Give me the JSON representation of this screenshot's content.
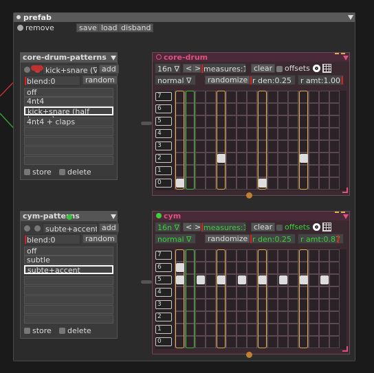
{
  "prefab": {
    "title": "prefab",
    "remove_label": "remove",
    "save_label": "save",
    "load_label": "load",
    "disband_label": "disband"
  },
  "drum_patterns": {
    "title": "core-drum-patterns",
    "selected": "kick+snare (∇",
    "add_label": "add",
    "blend": "blend:0",
    "random_label": "random",
    "items": [
      "off",
      "4nt4",
      "kick+snare (half tempo)",
      "4nt4 + claps"
    ],
    "store_label": "store",
    "delete_label": "delete"
  },
  "cym_patterns": {
    "title": "cym-patterns",
    "selected": "subte+accent",
    "add_label": "add",
    "blend": "blend:0",
    "random_label": "random",
    "items": [
      "off",
      "subtle",
      "subte+accent"
    ],
    "store_label": "store",
    "delete_label": "delete"
  },
  "core_drum": {
    "title": "core-drum",
    "rate": "16n ∇",
    "prev": "<",
    "next": ">",
    "measures": "measures:1",
    "clear_label": "clear",
    "offsets_label": "offsets",
    "mode": "normal  ∇",
    "randomize_label": "randomize",
    "r_den": "r den:0.25",
    "r_amt": "r amt:1.00",
    "rows": [
      "7",
      "6",
      "5",
      "4",
      "3",
      "2",
      "1",
      "0"
    ]
  },
  "cym": {
    "title": "cym",
    "rate": "16n ∇",
    "prev": "<",
    "next": ">",
    "measures": "measures:1",
    "clear_label": "clear",
    "offsets_label": "offsets",
    "mode": "normal  ∇",
    "randomize_label": "randomize",
    "r_den": "r den:0.25",
    "r_amt": "r amt:0.87",
    "rows": [
      "7",
      "6",
      "5",
      "4",
      "3",
      "2",
      "1",
      "0"
    ]
  },
  "colors": {
    "accent_yellow": "#e0b050",
    "accent_green": "#3ac03a",
    "seq_title_pink": "#e05080",
    "red_marker": "#e02020"
  }
}
